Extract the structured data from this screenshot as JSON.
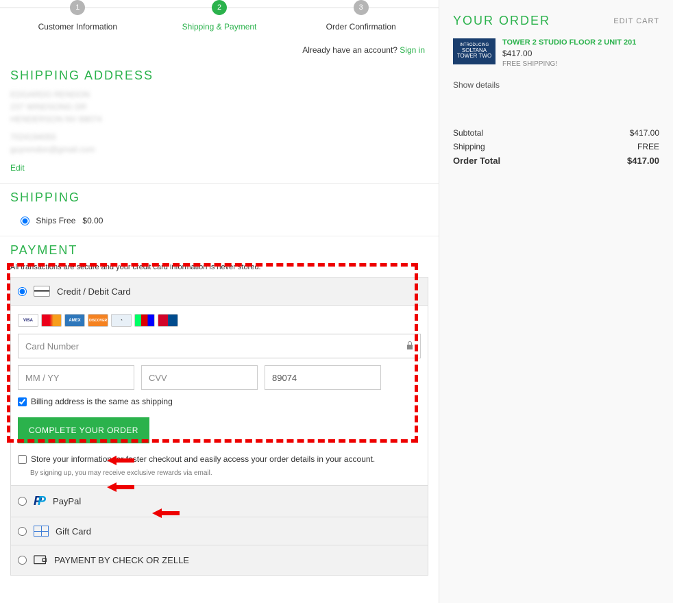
{
  "steps": {
    "s1": {
      "num": "1",
      "label": "Customer Information"
    },
    "s2": {
      "num": "2",
      "label": "Shipping & Payment"
    },
    "s3": {
      "num": "3",
      "label": "Order Confirmation"
    }
  },
  "signin": {
    "prompt": "Already have an account? ",
    "link": "Sign in"
  },
  "sections": {
    "shipping_address": "SHIPPING ADDRESS",
    "shipping": "SHIPPING",
    "payment": "PAYMENT"
  },
  "address": {
    "edit": "Edit"
  },
  "shipping_option": {
    "label": "Ships Free",
    "price": "$0.00"
  },
  "payment": {
    "note": "All transactions are secure and your credit card information is never stored.",
    "credit_label": "Credit / Debit Card",
    "card_number_ph": "Card Number",
    "exp_ph": "MM / YY",
    "cvv_ph": "CVV",
    "zip_value": "89074",
    "billing_same": "Billing address is the same as shipping",
    "complete_btn": "COMPLETE YOUR ORDER",
    "store_info": "Store your information for faster checkout and easily access your order details in your account.",
    "store_info_sub": "By signing up, you may receive exclusive rewards via email.",
    "paypal_label": "PayPal",
    "gift_label": "Gift Card",
    "check_label": "PAYMENT BY CHECK OR ZELLE"
  },
  "order": {
    "title": "YOUR ORDER",
    "edit_cart": "EDIT CART",
    "product": {
      "img_l1": "INTRODUCING",
      "img_l2": "SOLTANA",
      "img_l3": "TOWER TWO",
      "name": "TOWER 2 STUDIO FLOOR 2 UNIT 201",
      "price": "$417.00",
      "ship": "FREE SHIPPING!"
    },
    "show_details": "Show details",
    "subtotal_l": "Subtotal",
    "subtotal_v": "$417.00",
    "shipping_l": "Shipping",
    "shipping_v": "FREE",
    "total_l": "Order Total",
    "total_v": "$417.00"
  }
}
